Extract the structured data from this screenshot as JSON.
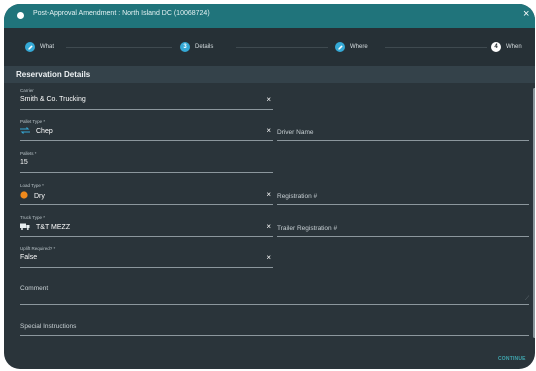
{
  "dialog": {
    "title": "Post-Approval Amendment : North Island DC (10068724)",
    "close": "×"
  },
  "stepper": {
    "steps": [
      {
        "label": "What",
        "icon": "pencil-icon",
        "number": "",
        "state": "done"
      },
      {
        "label": "Details",
        "icon": "",
        "number": "3",
        "state": "current"
      },
      {
        "label": "Where",
        "icon": "pencil-icon",
        "number": "",
        "state": "done"
      },
      {
        "label": "When",
        "icon": "",
        "number": "4",
        "state": "upcoming"
      }
    ]
  },
  "section": {
    "title": "Reservation Details"
  },
  "form": {
    "carrier": {
      "label": "Carrier",
      "value": "Smith & Co. Trucking"
    },
    "pallet_type": {
      "label": "Pallet Type *",
      "value": "Chep",
      "icon": "swap-icon"
    },
    "driver_name": {
      "placeholder": "Driver Name"
    },
    "pallets": {
      "label": "Pallets *",
      "value": "15"
    },
    "load_type": {
      "label": "Load Type *",
      "value": "Dry",
      "icon": "orange-dot-icon"
    },
    "registration": {
      "placeholder": "Registration #"
    },
    "truck_type": {
      "label": "Truck Type *",
      "value": "T&T MEZZ",
      "icon": "truck-icon"
    },
    "trailer_registration": {
      "placeholder": "Trailer Registration #"
    },
    "uplift_required": {
      "label": "Uplift Required? *",
      "value": "False"
    },
    "comment": {
      "placeholder": "Comment"
    },
    "special_instructions": {
      "placeholder": "Special Instructions"
    }
  },
  "clear_glyph": "×",
  "footer": {
    "continue_label": "CONTINUE"
  },
  "colors": {
    "accent": "#20747b",
    "stepper_icon": "#35a9d6",
    "load_dot": "#f08a1c",
    "link": "#3fa6ae"
  }
}
